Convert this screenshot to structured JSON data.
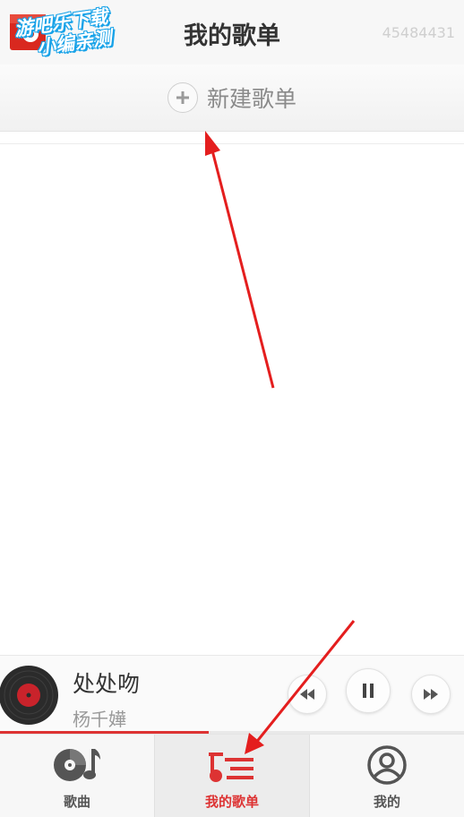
{
  "header": {
    "title": "我的歌单",
    "user_id": "45484431"
  },
  "watermark": {
    "line1": "游吧乐下载",
    "line2": "小编亲测"
  },
  "playlist": {
    "new_label": "新建歌单"
  },
  "player": {
    "song_title": "处处吻",
    "artist": "杨千嬅",
    "progress": 0.45,
    "icons": [
      "disc-icon",
      "previous-icon",
      "pause-icon",
      "next-icon"
    ]
  },
  "nav": {
    "items": [
      {
        "label": "歌曲",
        "icon": "songs-disc-note-icon",
        "active": false
      },
      {
        "label": "我的歌单",
        "icon": "playlist-icon",
        "active": true
      },
      {
        "label": "我的",
        "icon": "user-profile-icon",
        "active": false
      }
    ]
  },
  "colors": {
    "accent": "#dd3333",
    "annotation": "#e41e1e",
    "watermark": "#1aa3e8"
  }
}
